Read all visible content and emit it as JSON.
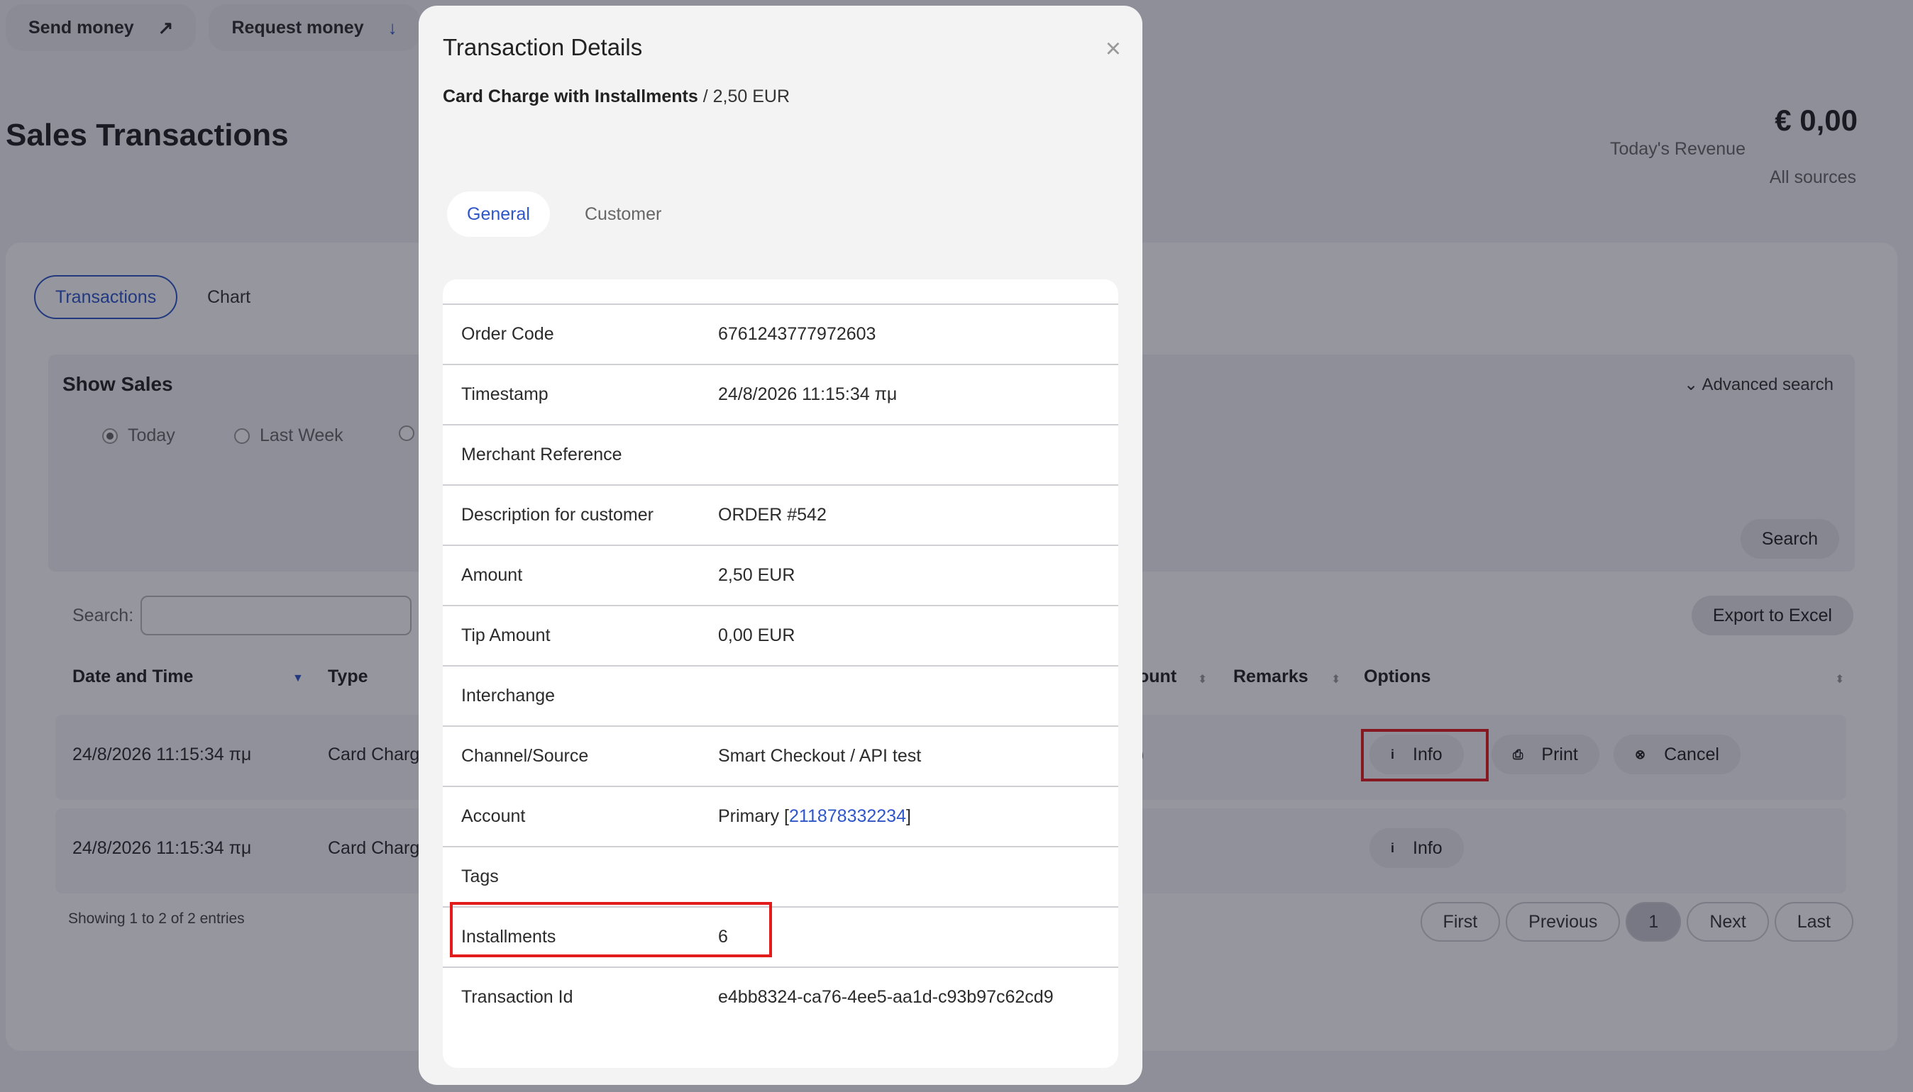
{
  "topbar": {
    "send_money": "Send money",
    "send_icon": "arrow-up-right-icon",
    "request_money": "Request money",
    "request_icon": "arrow-down-icon"
  },
  "page": {
    "title": "Sales Transactions",
    "revenue_amount": "€ 0,00",
    "revenue_label": "Today's Revenue",
    "revenue_sources": "All sources"
  },
  "tabs": {
    "transactions": "Transactions",
    "chart": "Chart"
  },
  "show_sales": {
    "title": "Show Sales",
    "advanced_search": "Advanced search",
    "radios": [
      "Today",
      "Last Week"
    ],
    "search_button": "Search"
  },
  "table_controls": {
    "search_label": "Search:",
    "search_value": "",
    "export_button": "Export to Excel"
  },
  "table": {
    "headers": {
      "date": "Date and Time",
      "type": "Type",
      "amount_partial": "ount",
      "remarks": "Remarks",
      "options": "Options"
    },
    "rows": [
      {
        "date": "24/8/2026 11:15:34 πμ",
        "type": "Card Charg",
        "amount_partial": ")"
      },
      {
        "date": "24/8/2026 11:15:34 πμ",
        "type": "Card Charg"
      }
    ],
    "buttons": {
      "info": "Info",
      "print": "Print",
      "cancel": "Cancel"
    },
    "showing": "Showing 1 to 2 of 2 entries",
    "pager": {
      "first": "First",
      "previous": "Previous",
      "current": "1",
      "next": "Next",
      "last": "Last"
    }
  },
  "modal": {
    "title": "Transaction Details",
    "close": "×",
    "subtitle_bold": "Card Charge with Installments",
    "subtitle_rest": " / 2,50 EUR",
    "tabs": {
      "general": "General",
      "customer": "Customer"
    },
    "details": [
      {
        "key": "Order Code",
        "value": "6761243777972603"
      },
      {
        "key": "Timestamp",
        "value": "24/8/2026 11:15:34 πμ"
      },
      {
        "key": "Merchant Reference",
        "value": ""
      },
      {
        "key": "Description for customer",
        "value": "ORDER #542"
      },
      {
        "key": "Amount",
        "value": "2,50 EUR"
      },
      {
        "key": "Tip Amount",
        "value": "0,00 EUR"
      },
      {
        "key": "Interchange",
        "value": ""
      },
      {
        "key": "Channel/Source",
        "value": "Smart Checkout / API test"
      },
      {
        "key": "Account",
        "value": "Primary [",
        "link": "211878332234",
        "suffix": "]"
      },
      {
        "key": "Tags",
        "value": ""
      },
      {
        "key": "Installments",
        "value": "6"
      },
      {
        "key": "Transaction Id",
        "value": "e4bb8324-ca76-4ee5-aa1d-c93b97c62cd9"
      }
    ]
  }
}
